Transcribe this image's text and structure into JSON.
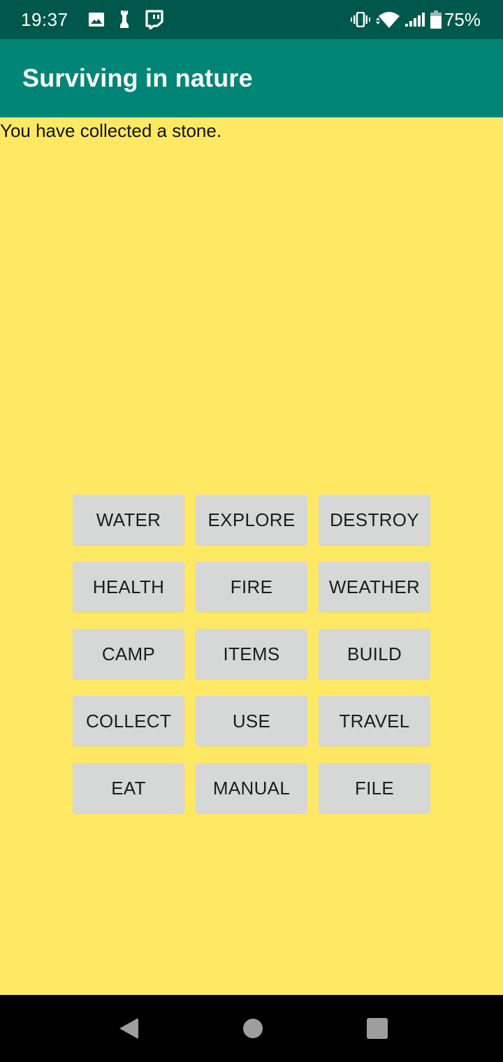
{
  "status_bar": {
    "time": "19:37",
    "left_icons": [
      "image-icon",
      "chess-piece-icon",
      "twitch-icon"
    ],
    "right_icons": [
      "vibrate-icon",
      "wifi-icon",
      "signal-icon",
      "battery-icon"
    ],
    "battery_percent": "75%"
  },
  "app_bar": {
    "title": "Surviving in nature"
  },
  "main": {
    "message": "You have collected a stone.",
    "actions": [
      {
        "label": "WATER"
      },
      {
        "label": "EXPLORE"
      },
      {
        "label": "DESTROY"
      },
      {
        "label": "HEALTH"
      },
      {
        "label": "FIRE"
      },
      {
        "label": "WEATHER"
      },
      {
        "label": "CAMP"
      },
      {
        "label": "ITEMS"
      },
      {
        "label": "BUILD"
      },
      {
        "label": "COLLECT"
      },
      {
        "label": "USE"
      },
      {
        "label": "TRAVEL"
      },
      {
        "label": "EAT"
      },
      {
        "label": "MANUAL"
      },
      {
        "label": "FILE"
      }
    ]
  },
  "nav_bar": {
    "buttons": [
      "back",
      "home",
      "recents"
    ]
  },
  "colors": {
    "status_bar": "#00574b",
    "app_bar": "#008577",
    "background": "#ffe864",
    "button": "#d6d7d7"
  }
}
